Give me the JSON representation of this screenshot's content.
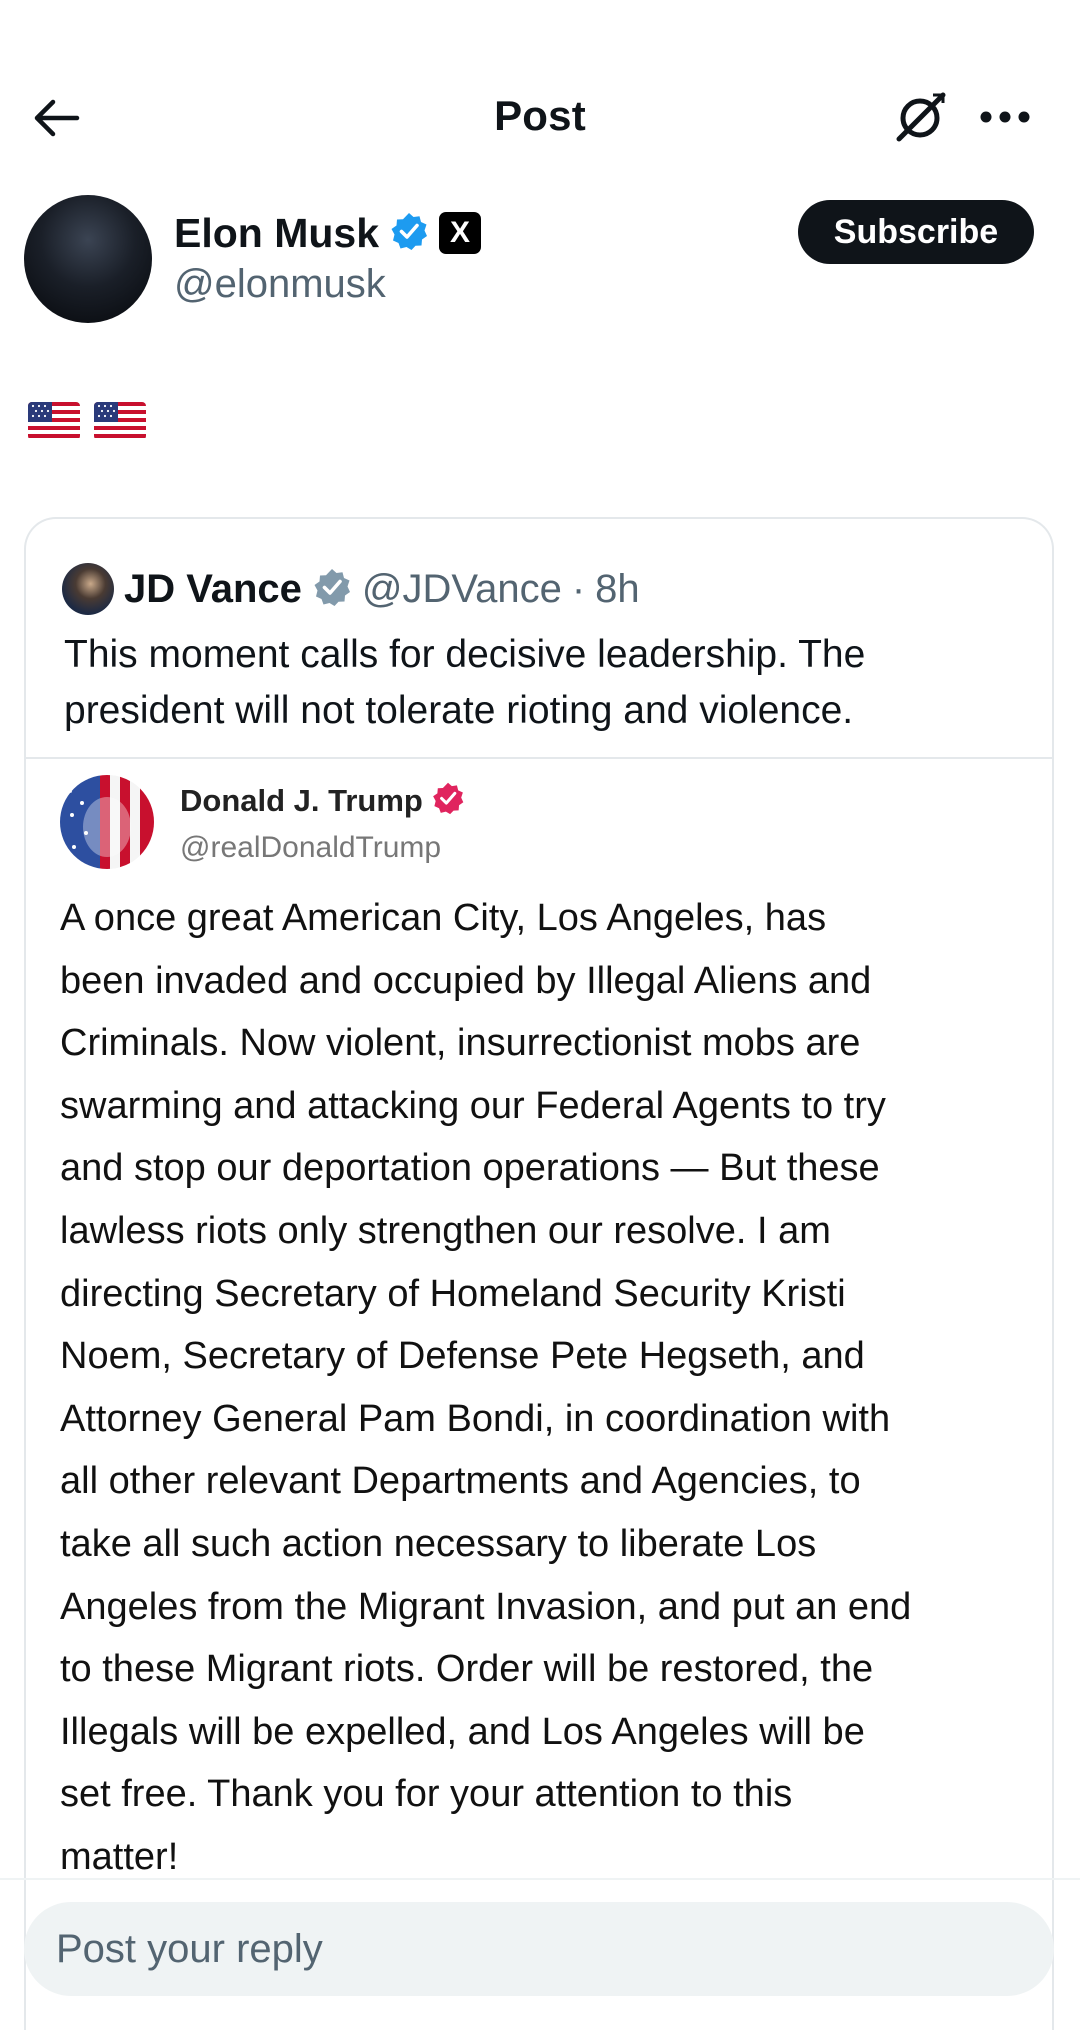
{
  "header": {
    "title": "Post",
    "back_icon": "arrow-left-icon",
    "grok_icon": "grok-icon",
    "more_icon": "more-dots-icon"
  },
  "author": {
    "name": "Elon Musk",
    "handle": "@elonmusk",
    "verified_badge": "verified-blue-icon",
    "affiliate_badge": "X",
    "subscribe_label": "Subscribe"
  },
  "post": {
    "content_emoji": [
      "us-flag",
      "us-flag"
    ]
  },
  "quoted_post": {
    "name": "JD Vance",
    "handle": "@JDVance",
    "separator": "·",
    "time": "8h",
    "verified_badge": "verified-gray-icon",
    "text": "This moment calls for decisive leadership. The president will not tolerate rioting and violence.",
    "embedded_screenshot": {
      "name": "Donald J. Trump",
      "handle": "@realDonaldTrump",
      "verified_badge": "verified-pink-icon",
      "text": "A once great American City, Los Angeles, has\nbeen invaded and occupied by Illegal Aliens and\nCriminals.  Now violent, insurrectionist mobs are\nswarming and attacking our Federal Agents to try\nand stop our deportation operations — But these\nlawless riots only strengthen our resolve. I am\ndirecting Secretary of Homeland Security Kristi\nNoem, Secretary of Defense Pete Hegseth, and\nAttorney General Pam Bondi, in coordination with\nall other relevant Departments and Agencies, to\ntake all such action necessary to liberate Los\nAngeles from the Migrant Invasion, and put an end\nto these Migrant riots. Order will be restored, the\nIllegals will be expelled, and Los Angeles will be\nset free. Thank you for your attention to this\nmatter!"
    }
  },
  "reply": {
    "placeholder": "Post your reply"
  },
  "colors": {
    "text_primary": "#0f1419",
    "text_secondary": "#536471",
    "verified_blue": "#1d9bf0",
    "verified_gray": "#829aab",
    "verified_pink": "#e0245e",
    "border": "#e4e8eb",
    "reply_bg": "#eff3f4"
  }
}
